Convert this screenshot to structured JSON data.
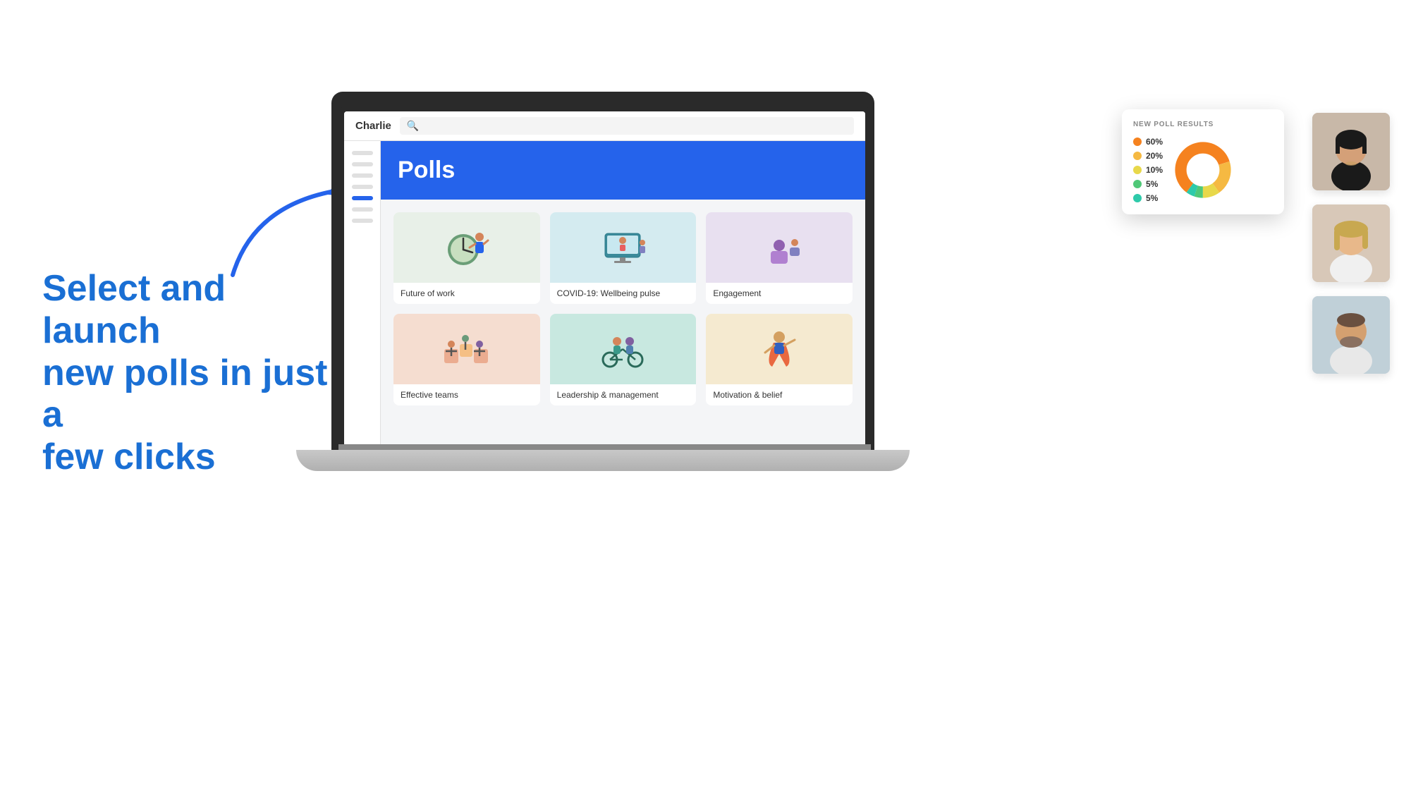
{
  "app": {
    "brand": "Charlie",
    "search_placeholder": ""
  },
  "headline": {
    "line1": "Select and launch",
    "line2": "new polls in just a",
    "line3": "few clicks"
  },
  "polls_page": {
    "title": "Polls",
    "cards": [
      {
        "id": "future-of-work",
        "label": "Future of work",
        "color_class": "card-future",
        "emoji": "🕰️"
      },
      {
        "id": "covid-wellbeing",
        "label": "COVID-19: Wellbeing pulse",
        "color_class": "card-covid",
        "emoji": "💻"
      },
      {
        "id": "engagement",
        "label": "Engagement",
        "color_class": "card-engagement",
        "emoji": "📊"
      },
      {
        "id": "effective-teams",
        "label": "Effective teams",
        "color_class": "card-teams",
        "emoji": "🧩"
      },
      {
        "id": "leadership",
        "label": "Leadership & management",
        "color_class": "card-leadership",
        "emoji": "🚴"
      },
      {
        "id": "motivation",
        "label": "Motivation & belief",
        "color_class": "card-motivation",
        "emoji": "🦸"
      }
    ]
  },
  "poll_results": {
    "title": "NEW POLL RESULTS",
    "items": [
      {
        "label": "60%",
        "color": "#f5821f",
        "pct": 60
      },
      {
        "label": "20%",
        "color": "#f5b942",
        "pct": 20
      },
      {
        "label": "10%",
        "color": "#e8d84a",
        "pct": 10
      },
      {
        "label": "5%",
        "color": "#50c878",
        "pct": 5
      },
      {
        "label": "5%",
        "color": "#2ecaaa",
        "pct": 5
      }
    ]
  },
  "sidebar": {
    "items": [
      {
        "active": false
      },
      {
        "active": false
      },
      {
        "active": false
      },
      {
        "active": false
      },
      {
        "active": true
      },
      {
        "active": false
      },
      {
        "active": false
      }
    ]
  },
  "colors": {
    "accent_blue": "#2563eb",
    "headline_blue": "#1a6fd4"
  }
}
